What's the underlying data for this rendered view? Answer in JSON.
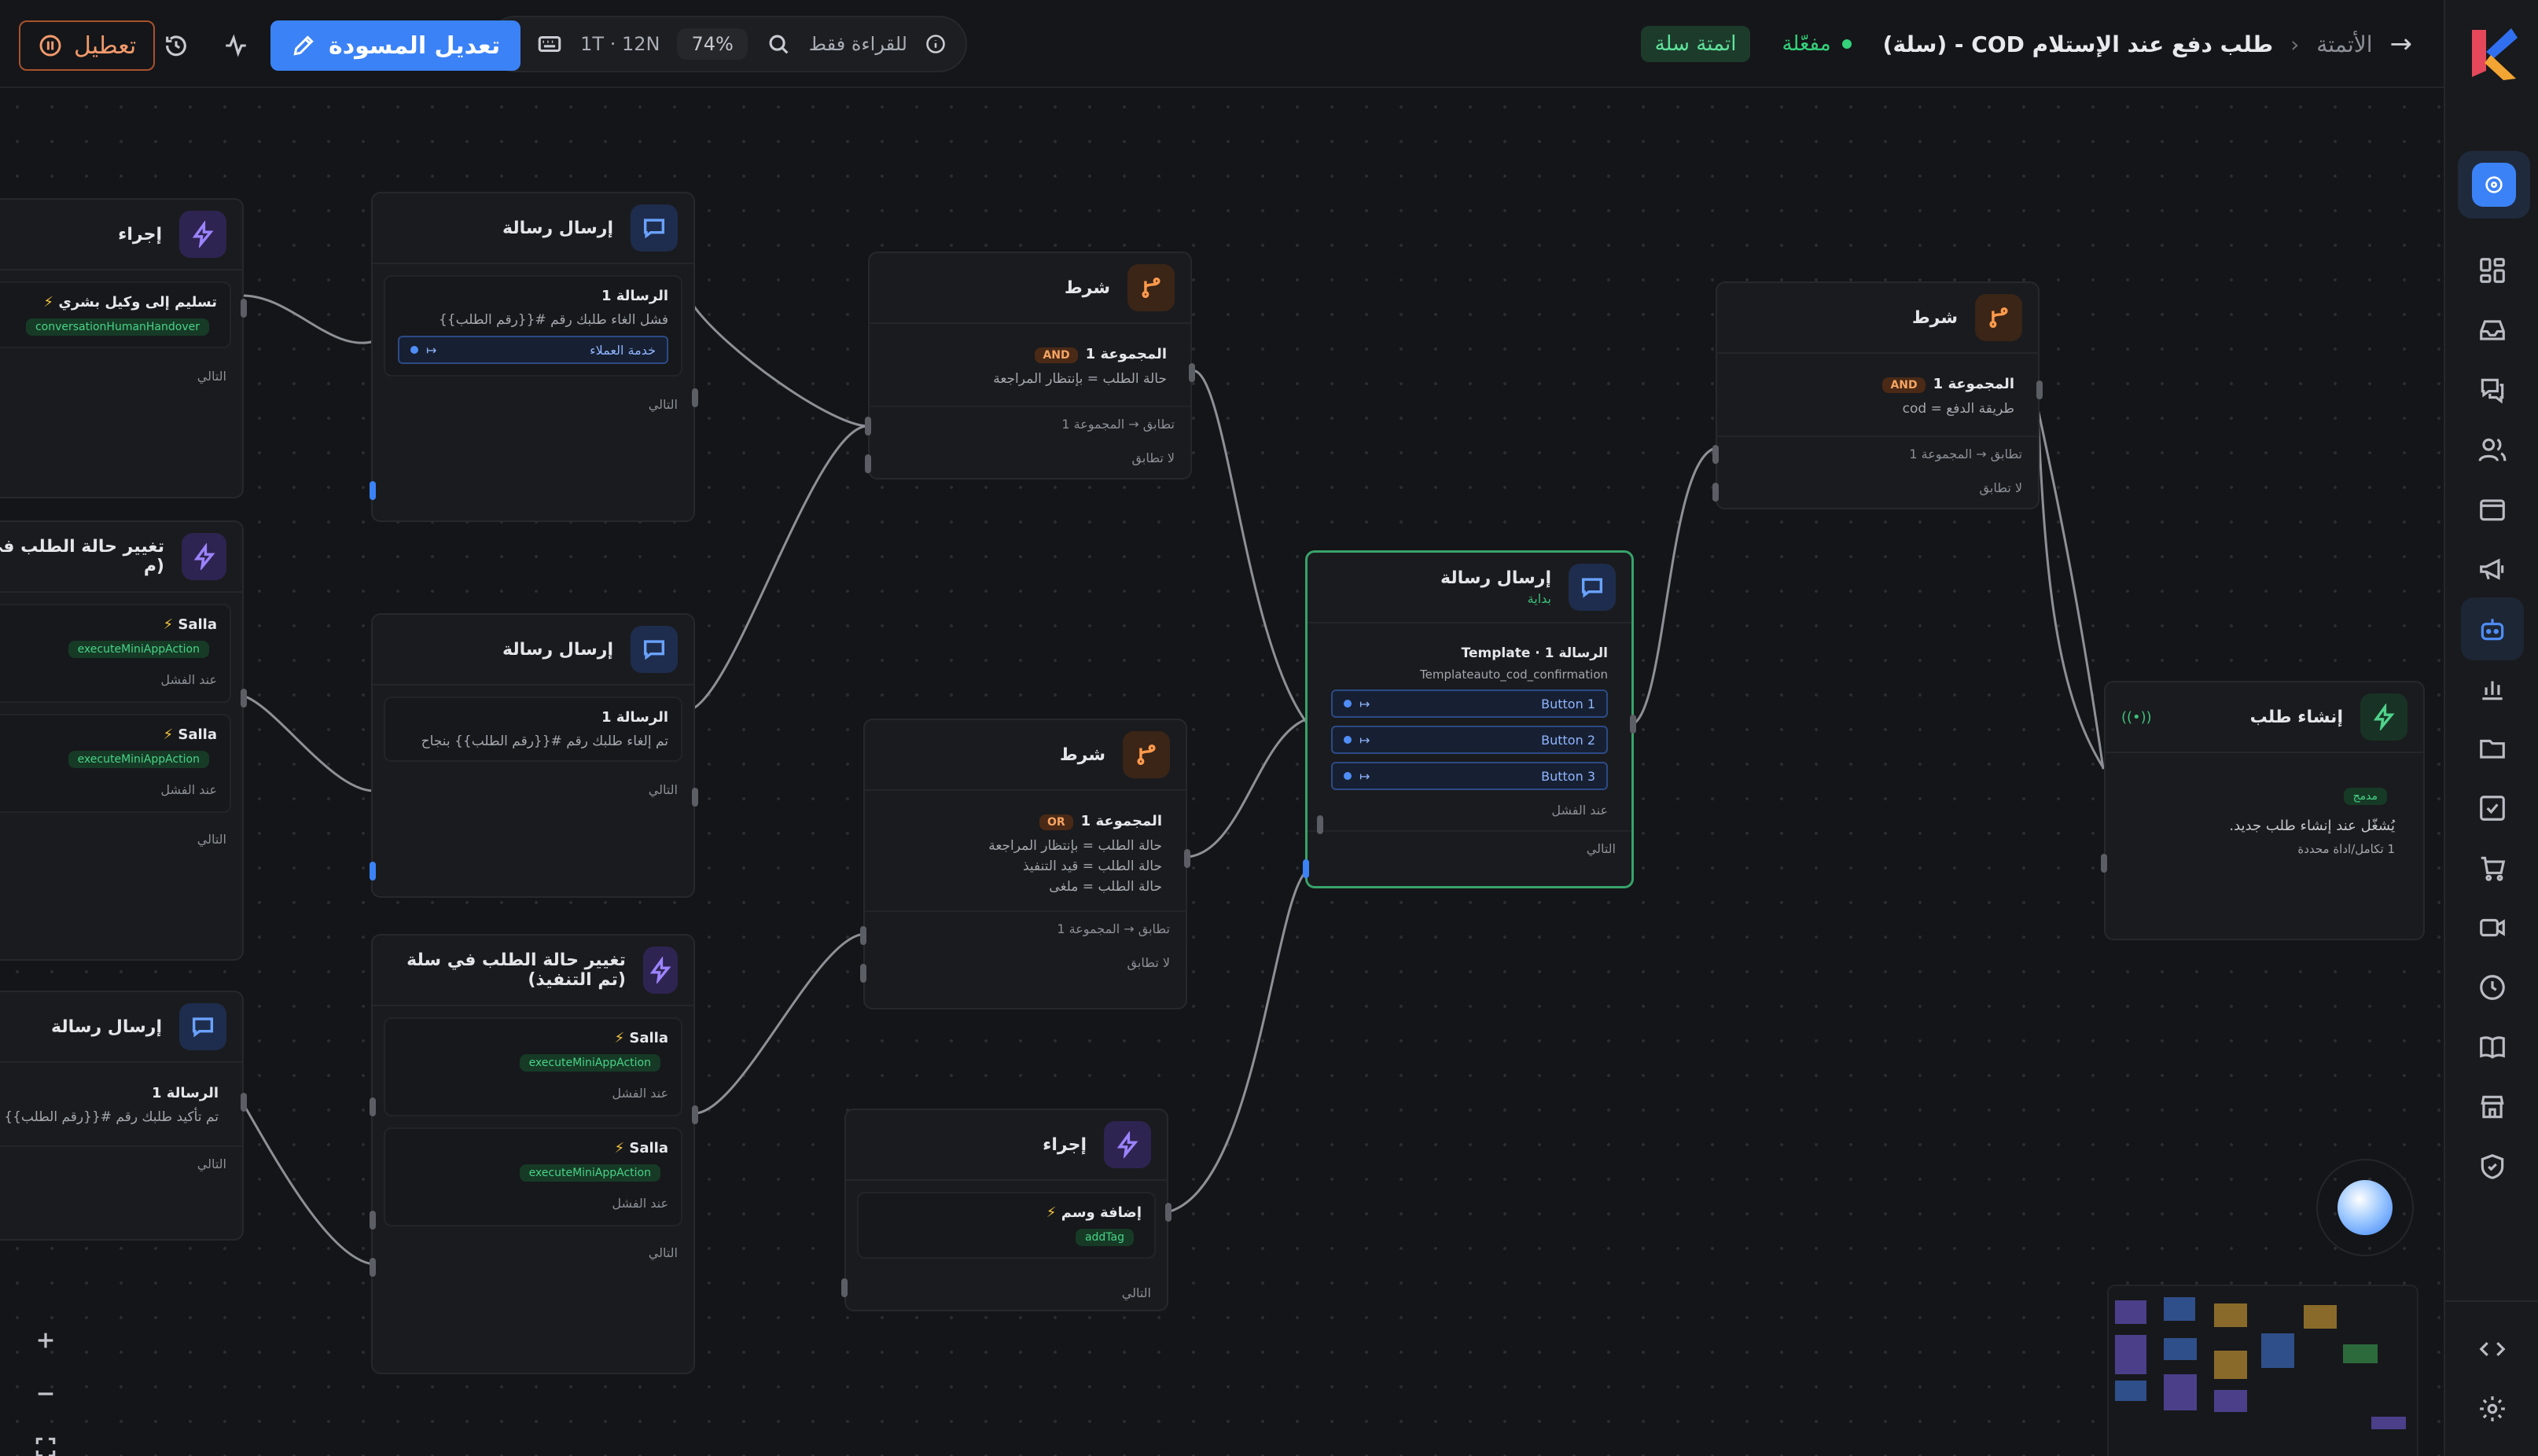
{
  "header": {
    "back_label": "الأتمتة",
    "title": "طلب دفع عند الإستلام COD - (سلة)",
    "status": "مفعّلة",
    "tag": "اتمتة سلة",
    "readonly": "للقراءة فقط",
    "zoom": "74%",
    "shortcut": "1T · 12N",
    "edit_draft": "تعديل المسودة",
    "disable": "تعطيل"
  },
  "nodes": {
    "trigger": {
      "title": "إنشاء طلب",
      "badge": "مدمج",
      "desc": "يُشغّل عند إنشاء طلب جديد.",
      "meta": "1 تكامل/اداة محددة"
    },
    "cond_top": {
      "title": "شرط",
      "group": "المجموعة 1",
      "op": "AND",
      "line1": "طريقة الدفع = cod",
      "match": "تطابق → المجموعة 1",
      "nomatch": "لا تطابق"
    },
    "msg_center": {
      "title": "إرسال رسالة",
      "subtitle": "بداية",
      "msg": "الرسالة 1 · Template",
      "template": "Templateauto_cod_confirmation",
      "b1": "Button 1",
      "b2": "Button 2",
      "b3": "Button 3",
      "fail": "عند الفشل",
      "next": "التالي"
    },
    "cond_a": {
      "title": "شرط",
      "group": "المجموعة 1",
      "op": "AND",
      "line1": "حالة الطلب = بإنتظار المراجعة",
      "match": "تطابق → المجموعة 1",
      "nomatch": "لا تطابق"
    },
    "cond_b": {
      "title": "شرط",
      "group": "المجموعة 1",
      "op": "OR",
      "line1": "حالة الطلب = بإنتظار المراجعة",
      "line2": "حالة الطلب = قيد التنفيذ",
      "line3": "حالة الطلب = ملغى",
      "match": "تطابق → المجموعة 1",
      "nomatch": "لا تطابق"
    },
    "act_tag": {
      "title": "إجراء",
      "action": "إضافة وسم",
      "fn": "addTag",
      "next": "التالي"
    },
    "msg_cancel_fail": {
      "title": "إرسال رسالة",
      "msg": "الرسالة 1",
      "text": "فشل الغاء طلبك رقم #{{رقم الطلب}}",
      "btn": "خدمة العملاء",
      "next": "التالي"
    },
    "msg_cancel_ok": {
      "title": "إرسال رسالة",
      "msg": "الرسالة 1",
      "text": "تم إلغاء طلبك رقم #{{رقم الطلب}} بنجاح",
      "next": "التالي"
    },
    "act_status_exec": {
      "title": "تغيير حالة الطلب في سلة (تم التنفيذ)",
      "vendor": "Salla",
      "fn": "executeMiniAppAction",
      "fail": "عند الفشل",
      "next": "التالي"
    },
    "act_handover": {
      "title": "إجراء",
      "action": "تسليم إلى وكيل بشري",
      "fn": "conversationHumanHandover",
      "next": "التالي"
    },
    "act_status_left": {
      "title": "تغيير حالة الطلب في سلة (م",
      "vendor": "Salla",
      "fn": "executeMiniAppAction",
      "fail": "عند الفشل",
      "next": "التالي"
    },
    "msg_left": {
      "title": "إرسال رسالة",
      "msg": "الرسالة 1",
      "text": "تم تأكيد طلبك رقم #{{رقم الطلب}} بنجا",
      "next": "التالي"
    }
  },
  "colors": {
    "accent": "#3b82f6",
    "success": "#34d27b",
    "warn": "#f29a6c"
  }
}
